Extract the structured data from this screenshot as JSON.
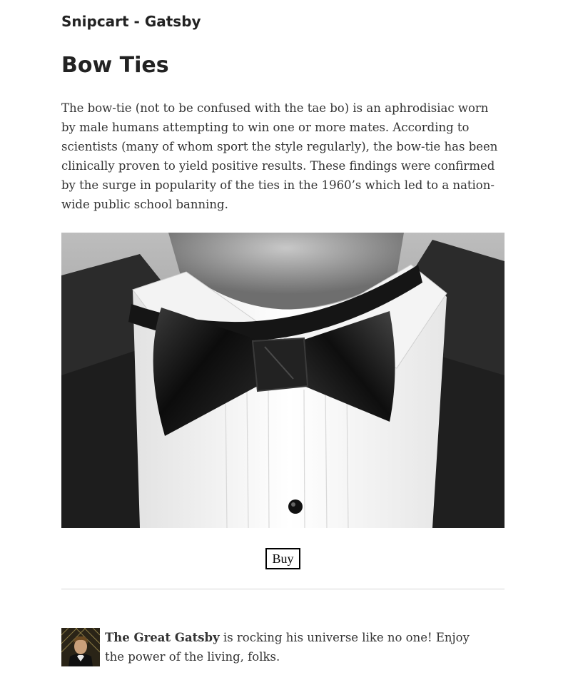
{
  "site": {
    "title": "Snipcart - Gatsby"
  },
  "product": {
    "name": "Bow Ties",
    "description": "The bow-tie (not to be confused with the tae bo) is an aphrodisiac worn by male humans attempting to win one or more mates. According to scientists (many of whom sport the style regularly), the bow-tie has been clinically proven to yield positive results. These findings were confirmed by the surge in popularity of the ties in the 1960’s which led to a nation-wide public school banning.",
    "buy_label": "Buy"
  },
  "bio": {
    "name": "The Great Gatsby",
    "text": " is rocking his universe like no one! Enjoy the power of the living, folks."
  }
}
